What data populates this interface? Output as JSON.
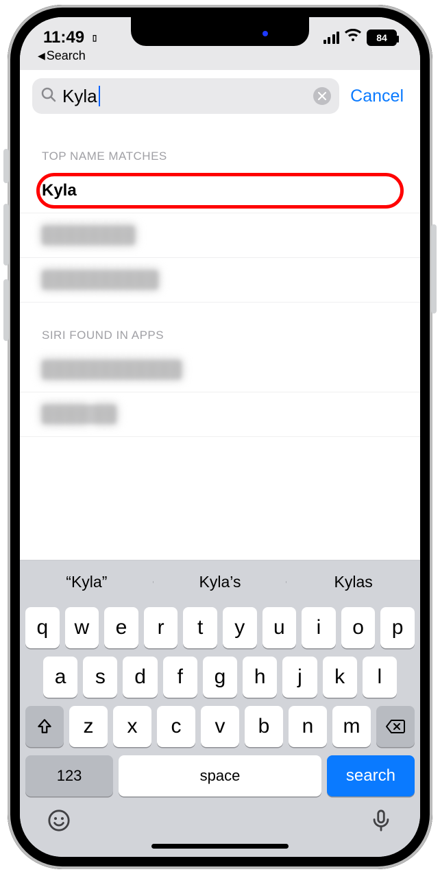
{
  "status": {
    "time": "11:49",
    "battery": "84",
    "back_label": "Search"
  },
  "search": {
    "query": "Kyla",
    "cancel_label": "Cancel"
  },
  "sections": {
    "matches_header": "TOP NAME MATCHES",
    "matches": {
      "item0": "Kyla",
      "item1": "████████",
      "item2": "██████████"
    },
    "siri_header": "SIRI FOUND IN APPS",
    "siri": {
      "item0": "████████████",
      "item1": "████ ██"
    }
  },
  "keyboard": {
    "suggestions": {
      "s0": "“Kyla”",
      "s1": "Kyla’s",
      "s2": "Kylas"
    },
    "row1": {
      "k0": "q",
      "k1": "w",
      "k2": "e",
      "k3": "r",
      "k4": "t",
      "k5": "y",
      "k6": "u",
      "k7": "i",
      "k8": "o",
      "k9": "p"
    },
    "row2": {
      "k0": "a",
      "k1": "s",
      "k2": "d",
      "k3": "f",
      "k4": "g",
      "k5": "h",
      "k6": "j",
      "k7": "k",
      "k8": "l"
    },
    "row3": {
      "k0": "z",
      "k1": "x",
      "k2": "c",
      "k3": "v",
      "k4": "b",
      "k5": "n",
      "k6": "m"
    },
    "num_label": "123",
    "space_label": "space",
    "search_label": "search"
  }
}
